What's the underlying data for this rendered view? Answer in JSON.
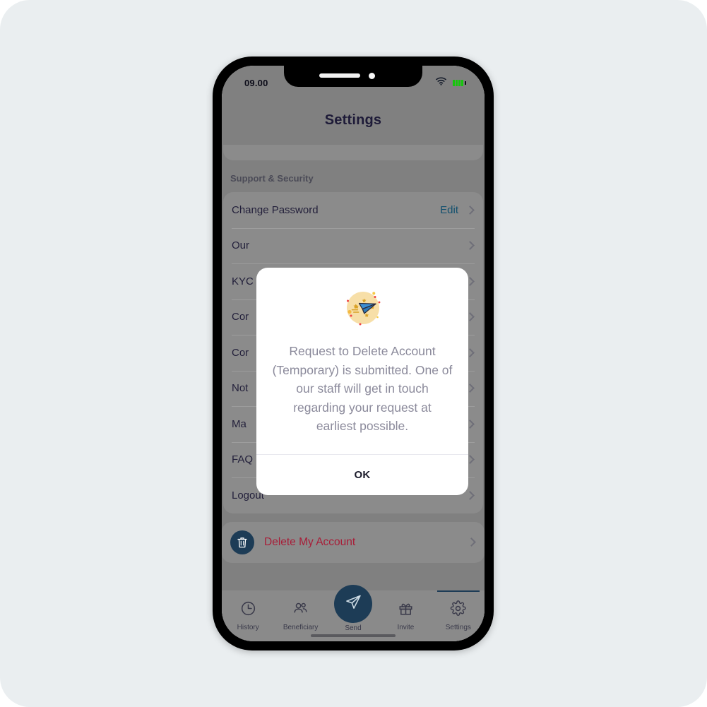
{
  "status_bar": {
    "time": "09.00",
    "wifi_icon": "wifi-icon",
    "battery_icon": "battery-icon"
  },
  "header": {
    "title": "Settings"
  },
  "settings": {
    "section_title": "Support & Security",
    "rows": [
      {
        "label": "Change Password",
        "action": "Edit"
      },
      {
        "label": "Our",
        "action": ""
      },
      {
        "label": "KYC",
        "action": ""
      },
      {
        "label": "Cor",
        "action": ""
      },
      {
        "label": "Cor",
        "action": ""
      },
      {
        "label": "Not",
        "action": ""
      },
      {
        "label": "Ma",
        "action": ""
      },
      {
        "label": "FAQ",
        "action": ""
      },
      {
        "label": "Logout",
        "action": ""
      }
    ],
    "delete_account": {
      "label": "Delete My Account",
      "icon": "trash-icon",
      "color": "#a81d38"
    }
  },
  "modal": {
    "icon": "paper-plane-sent-icon",
    "message": "Request to Delete Account (Temporary) is submitted. One of our staff will get in touch regarding your request at earliest possible.",
    "ok_label": "OK"
  },
  "tabbar": {
    "items": [
      {
        "label": "History",
        "icon": "clock-icon",
        "active": false
      },
      {
        "label": "Beneficiary",
        "icon": "people-icon",
        "active": false
      },
      {
        "label": "Send",
        "icon": "paper-plane-icon",
        "active": false
      },
      {
        "label": "Invite",
        "icon": "gift-icon",
        "active": false
      },
      {
        "label": "Settings",
        "icon": "gear-icon",
        "active": true
      }
    ]
  },
  "colors": {
    "brand": "#1d3c56",
    "danger": "#a81d38",
    "link": "#12506e",
    "page_background": "#eaeef0"
  }
}
